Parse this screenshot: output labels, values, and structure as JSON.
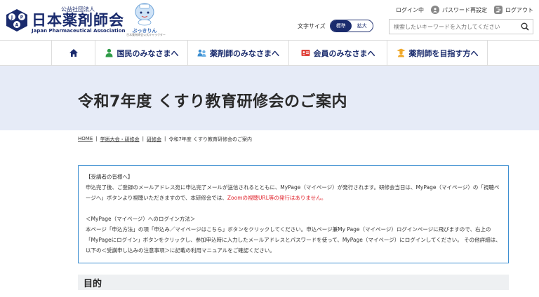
{
  "header": {
    "org_type": "公益社団法人",
    "org_name": "日本薬剤師会",
    "org_en": "Japan Pharmaceutical Association",
    "mascot_name": "ぶっきりん",
    "mascot_caption": "日本薬剤師会公式キャラクター",
    "links": {
      "login_status": "ログイン中",
      "password_reset": "パスワード再設定",
      "logout": "ログアウト"
    },
    "font_size": {
      "label": "文字サイズ",
      "standard": "標準",
      "large": "拡大"
    },
    "search": {
      "placeholder": "検索したいキーワードを入力してください"
    }
  },
  "nav": {
    "items": [
      {
        "label": "",
        "icon": "home-icon"
      },
      {
        "label": "国民のみなさまへ",
        "icon": "person-icon",
        "color": "#2e9b47"
      },
      {
        "label": "薬剤師のみなさまへ",
        "icon": "people-icon",
        "color": "#3d8fd1"
      },
      {
        "label": "会員のみなさまへ",
        "icon": "id-card-icon",
        "color": "#e0433b"
      },
      {
        "label": "薬剤師を目指す方へ",
        "icon": "student-icon",
        "color": "#f0a92b"
      }
    ]
  },
  "page": {
    "title": "令和7年度 くすり教育研修会のご案内"
  },
  "breadcrumb": {
    "items": [
      "HOME",
      "学術大会・研修会",
      "研修会",
      "令和7年度 くすり教育研修会のご案内"
    ],
    "separator": "|"
  },
  "notice": {
    "heading1": "【受講者の皆様へ】",
    "para1": "申込完了後、ご登録のメールアドレス宛に申込完了メールが送信されるとともに、MyPage（マイページ）が発行されます。研修会当日は、MyPage（マイページ）の「視聴ページへ」ボタンより視聴いただきますので、本研修会では、",
    "para1_red": "Zoomの視聴URL等の発行はありません。",
    "heading2": "＜MyPage（マイページ）へのログイン方法＞",
    "para2": "本ページ「申込方法」の項「申込み／マイページはこちら」ボタンをクリックしてください。申込ページ兼My Page（マイページ）ログインページに飛びますので、右上の「MyPageにログイン」ボタンをクリックし、参加申込時に入力したメールアドレスとパスワードを使って、MyPage（マイページ）にログインしてください。 その他詳細は、以下の＜受講申し込みの注意事項＞に記載の利用マニュアルをご確認ください。"
  },
  "section": {
    "title": "目的"
  },
  "colors": {
    "brand": "#1a2b6d",
    "title_band": "#e6ebf7",
    "notice_border": "#3d8fd1",
    "alert": "#e0242d"
  }
}
